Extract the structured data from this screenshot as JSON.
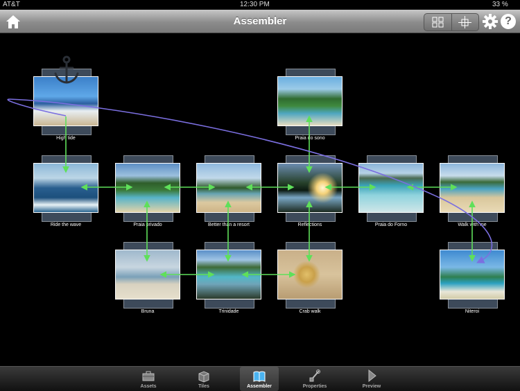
{
  "status": {
    "carrier": "AT&T",
    "time": "12:30 PM",
    "battery": "33 %"
  },
  "navbar": {
    "title": "Assembler"
  },
  "tiles": [
    {
      "label": "High tide"
    },
    {
      "label": "Praia do sono"
    },
    {
      "label": "Ride the wave"
    },
    {
      "label": "Praia privado"
    },
    {
      "label": "Better than a resort"
    },
    {
      "label": "Reflections"
    },
    {
      "label": "Praia do Forno"
    },
    {
      "label": "Walk with me"
    },
    {
      "label": "Bruna"
    },
    {
      "label": "Trinidade"
    },
    {
      "label": "Crab walk"
    },
    {
      "label": "Niteroi"
    }
  ],
  "tabs": [
    {
      "label": "Assets"
    },
    {
      "label": "Tiles"
    },
    {
      "label": "Assembler"
    },
    {
      "label": "Properties"
    },
    {
      "label": "Preview"
    }
  ],
  "colors": {
    "link": "#5fe05a",
    "path": "#7b6fe0",
    "anchor": "#2a2f36"
  }
}
